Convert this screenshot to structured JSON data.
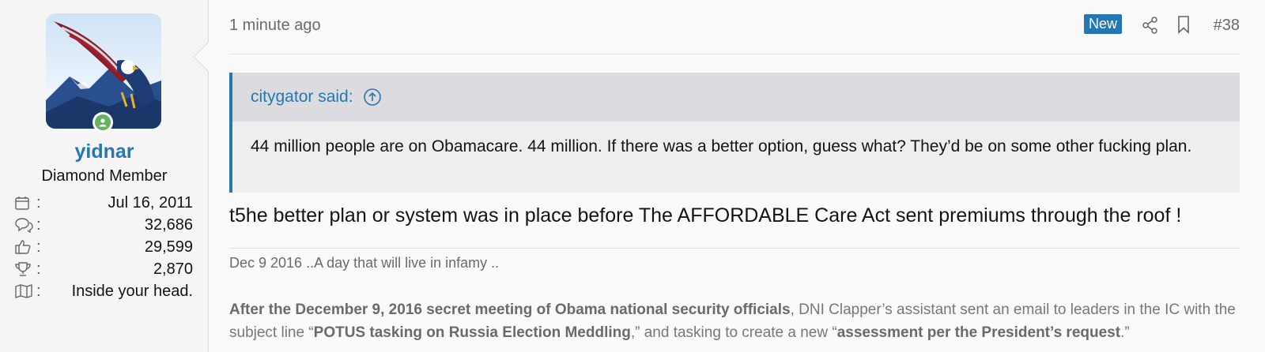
{
  "user": {
    "username": "yidnar",
    "title": "Diamond Member",
    "stats": [
      {
        "icon": "calendar-icon",
        "value": "Jul 16, 2011"
      },
      {
        "icon": "messages-icon",
        "value": "32,686"
      },
      {
        "icon": "thumbs-up-icon",
        "value": "29,599"
      },
      {
        "icon": "trophy-icon",
        "value": "2,870"
      },
      {
        "icon": "location-map-icon",
        "value": "Inside your head."
      }
    ]
  },
  "post": {
    "time": "1 minute ago",
    "new_badge": "New",
    "number": "#38",
    "quote_author": "citygator said:",
    "quote_text": "44 million people are on Obamacare. 44 million. If there was a better option, guess what? They’d be on some other fucking plan.",
    "message": "t5he better plan or system was in place before The AFFORDABLE Care Act sent premiums through the roof !"
  },
  "signature": {
    "line1": "Dec 9 2016 ..A day that will live in infamy ..",
    "p1_bold": "After the December 9, 2016 secret meeting of Obama national security officials",
    "p1_text1": ", DNI Clapper’s assistant sent an email to leaders in the IC with the subject line “",
    "p1_bold2": "POTUS tasking on Russia Election Meddling",
    "p1_text2": ",” and tasking to create a new “",
    "p1_bold3": "assessment per the President’s request",
    "p1_text3": ".”"
  },
  "colors": {
    "accent": "#2577b1",
    "online": "#63b35f"
  }
}
